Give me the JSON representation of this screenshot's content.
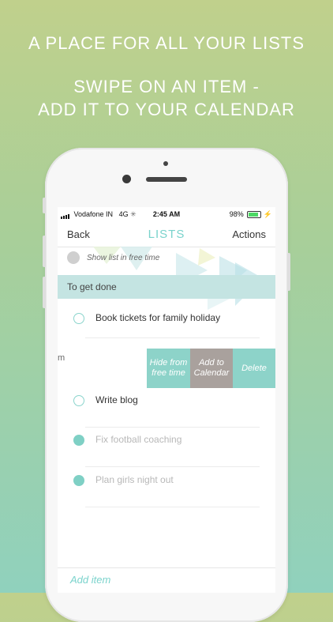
{
  "headline": {
    "line1": "A PLACE FOR ALL YOUR LISTS",
    "line2": "SWIPE ON AN ITEM -",
    "line3": "ADD IT TO YOUR CALENDAR"
  },
  "status_bar": {
    "carrier": "Vodafone IN",
    "network": "4G",
    "time": "2:45 AM",
    "battery": "98%"
  },
  "nav": {
    "back": "Back",
    "title": "LISTS",
    "actions": "Actions",
    "accent_color": "#7ad3cc"
  },
  "toggle": {
    "label": "Show list in free time"
  },
  "section": {
    "title": "To get done"
  },
  "items": [
    {
      "label": "Book tickets for family holiday",
      "done": false
    },
    {
      "label": "Write blog",
      "done": false
    },
    {
      "label": "Fix football coaching",
      "done": true
    },
    {
      "label": "Plan girls night out",
      "done": true
    }
  ],
  "swipe_row": {
    "leftover_text": "m",
    "actions": {
      "hide": "Hide from free time",
      "calendar": "Add to Calendar",
      "delete": "Delete"
    }
  },
  "add_item": "Add item"
}
